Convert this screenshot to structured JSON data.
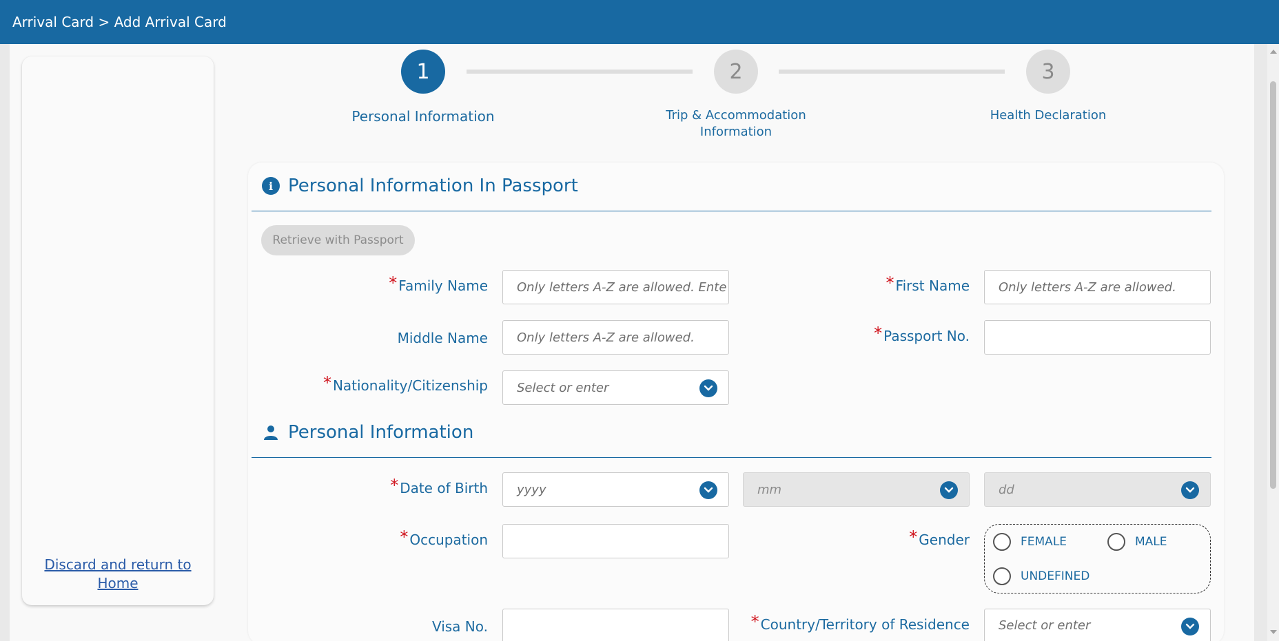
{
  "header": {
    "breadcrumb": "Arrival Card > Add Arrival Card"
  },
  "sidebar": {
    "discard_link": "Discard and return to Home"
  },
  "steps": [
    {
      "number": "1",
      "label": "Personal Information",
      "state": "active"
    },
    {
      "number": "2",
      "label": "Trip & Accommodation Information",
      "state": "inactive"
    },
    {
      "number": "3",
      "label": "Health Declaration",
      "state": "inactive"
    }
  ],
  "passport_section": {
    "title": "Personal Information In Passport",
    "icon": "info-icon",
    "retrieve_button": "Retrieve with Passport",
    "fields": {
      "family_name": {
        "label": "Family Name",
        "required": true,
        "value": "",
        "placeholder": "Only letters A-Z are allowed. Ente"
      },
      "first_name": {
        "label": "First Name",
        "required": true,
        "value": "",
        "placeholder": "Only letters A-Z are allowed."
      },
      "middle_name": {
        "label": "Middle Name",
        "required": false,
        "value": "",
        "placeholder": "Only letters A-Z are allowed."
      },
      "passport_no": {
        "label": "Passport No.",
        "required": true,
        "value": "",
        "placeholder": ""
      },
      "nationality": {
        "label": "Nationality/Citizenship",
        "required": true,
        "value": "",
        "placeholder": "Select or enter"
      }
    }
  },
  "personal_section": {
    "title": "Personal Information",
    "icon": "person-icon",
    "fields": {
      "date_of_birth": {
        "label": "Date of Birth",
        "required": true,
        "year_placeholder": "yyyy",
        "month_placeholder": "mm",
        "day_placeholder": "dd"
      },
      "occupation": {
        "label": "Occupation",
        "required": true,
        "value": ""
      },
      "gender": {
        "label": "Gender",
        "required": true,
        "options": [
          "FEMALE",
          "MALE",
          "UNDEFINED"
        ],
        "selected": null
      },
      "visa_no": {
        "label": "Visa No.",
        "required": false,
        "value": ""
      },
      "country_residence": {
        "label": "Country/Territory of Residence",
        "required": true,
        "placeholder": "Select or enter"
      }
    }
  },
  "required_marker": "*",
  "colors": {
    "brand": "#1869a2",
    "required": "#d0141d",
    "label": "#1c6aa0"
  }
}
